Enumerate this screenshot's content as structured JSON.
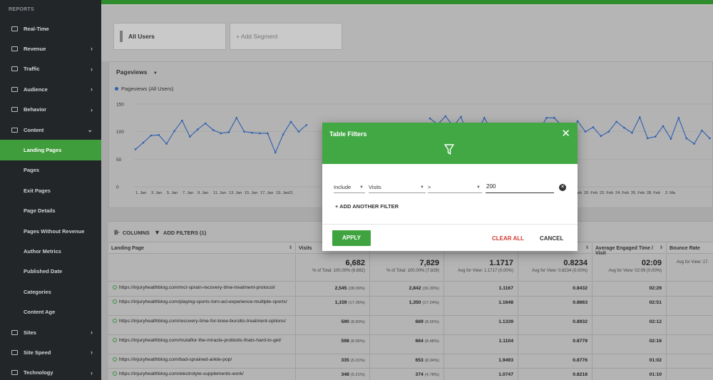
{
  "sidebar": {
    "section": "REPORTS",
    "items": [
      {
        "label": "Real-Time",
        "icon": "video-icon"
      },
      {
        "label": "Revenue",
        "icon": "money-icon"
      },
      {
        "label": "Traffic",
        "icon": "flag-icon"
      },
      {
        "label": "Audience",
        "icon": "people-icon"
      },
      {
        "label": "Behavior",
        "icon": "behavior-icon"
      },
      {
        "label": "Content",
        "icon": "content-icon"
      }
    ],
    "content_items": [
      "Landing Pages",
      "Pages",
      "Exit Pages",
      "Page Details",
      "Pages Without Revenue",
      "Author Metrics",
      "Published Date",
      "Categories",
      "Content Age"
    ],
    "bottom_items": [
      {
        "label": "Sites",
        "icon": "globe-icon"
      },
      {
        "label": "Site Speed",
        "icon": "speed-icon"
      },
      {
        "label": "Technology",
        "icon": "monitor-icon"
      }
    ]
  },
  "segments": {
    "all_users": "All Users",
    "add_segment": "+ Add Segment"
  },
  "chart": {
    "metric_label": "Pageviews",
    "legend": "Pageviews (All Users)",
    "series_color": "#2e5fb0"
  },
  "chart_data": {
    "type": "line",
    "y_ticks": [
      "150",
      "100",
      "50",
      "0"
    ],
    "ylim": [
      0,
      150
    ],
    "x_labels": [
      "1. Jan",
      "3. Jan",
      "5. Jan",
      "7. Jan",
      "9. Jan",
      "11. Jan",
      "13. Jan",
      "15. Jan",
      "17. Jan",
      "19. Jan",
      "21",
      "18. Feb",
      "20. Feb",
      "22. Feb",
      "24. Feb",
      "26. Feb",
      "28. Feb",
      "2. Ma"
    ],
    "series": [
      {
        "name": "Pageviews (All Users)",
        "left_values": [
          68,
          80,
          93,
          94,
          78,
          101,
          120,
          91,
          104,
          115,
          103,
          97,
          99,
          125,
          100,
          98,
          97,
          97,
          62,
          95,
          118,
          100,
          112
        ],
        "right_values": [
          124,
          113,
          128,
          110,
          127,
          88,
          97,
          125,
          100,
          109,
          104,
          98,
          100,
          108,
          100,
          125,
          125,
          110,
          98,
          119,
          100,
          108,
          92,
          100,
          118,
          107,
          98,
          126,
          88,
          91,
          110,
          87,
          125,
          88,
          78,
          102,
          88
        ]
      }
    ]
  },
  "toolbar": {
    "columns": "COLUMNS",
    "add_filters": "ADD FILTERS (1)"
  },
  "table": {
    "headers": [
      "Landing Page",
      "Visits",
      "",
      "",
      "",
      "Average Engaged Time / Visit",
      "Bounce Rate"
    ],
    "totals": [
      {
        "big": "6,682",
        "small": "% of Total: 100.00% (6,682)"
      },
      {
        "big": "7,829",
        "small": "% of Total: 100.00% (7,829)"
      },
      {
        "big": "1.1717",
        "small": "Avg for View: 1.1717 (0.00%)"
      },
      {
        "big": "0.8234",
        "small": "Avg for View: 0.8234 (0.00%)"
      },
      {
        "big": "02:09",
        "small": "Avg for View: 02:09 (0.00%)"
      },
      {
        "big": "",
        "small": "Avg for View: 17."
      }
    ],
    "rows": [
      {
        "page": "https://injuryhealthblog.com/mcl-sprain-recovery-time-treatment-protocol/",
        "c1": "2,545",
        "c1p": "(38.09%)",
        "c2": "2,842",
        "c2p": "(36.30%)",
        "c3": "1.1167",
        "c4": "0.8432",
        "c5": "02:29"
      },
      {
        "page": "https://injuryhealthblog.com/playing-sports-torn-acl-experience-multiple-sports/",
        "c1": "1,159",
        "c1p": "(17.35%)",
        "c2": "1,350",
        "c2p": "(17.24%)",
        "c3": "1.1648",
        "c4": "0.8663",
        "c5": "02:51"
      },
      {
        "page": "https://injuryhealthblog.com/recovery-time-for-knee-bursitis-treatment-options/",
        "c1": "590",
        "c1p": "(8.83%)",
        "c2": "669",
        "c2p": "(8.55%)",
        "c3": "1.1339",
        "c4": "0.8932",
        "c5": "02:12"
      },
      {
        "page": "https://injuryhealthblog.com/mutaflor-the-miracle-probiotic-thats-hard-to-get/",
        "c1": "598",
        "c1p": "(8.95%)",
        "c2": "664",
        "c2p": "(8.48%)",
        "c3": "1.1104",
        "c4": "0.8779",
        "c5": "02:16"
      },
      {
        "page": "https://injuryhealthblog.com/bad-sprained-ankle-pop/",
        "c1": "335",
        "c1p": "(5.01%)",
        "c2": "653",
        "c2p": "(8.34%)",
        "c3": "1.9493",
        "c4": "0.8776",
        "c5": "01:02"
      },
      {
        "page": "https://injuryhealthblog.com/electrolyte-supplements-work/",
        "c1": "348",
        "c1p": "(5.21%)",
        "c2": "374",
        "c2p": "(4.78%)",
        "c3": "1.0747",
        "c4": "0.8218",
        "c5": "01:10"
      }
    ]
  },
  "modal": {
    "title": "Table Filters",
    "include": "Include",
    "metric": "Visits",
    "operator": ">",
    "value": "200",
    "add_another": "+ ADD ANOTHER FILTER",
    "apply": "APPLY",
    "clear_all": "CLEAR ALL",
    "cancel": "CANCEL",
    "header_color": "#42a844",
    "clear_color": "#d23a33"
  }
}
